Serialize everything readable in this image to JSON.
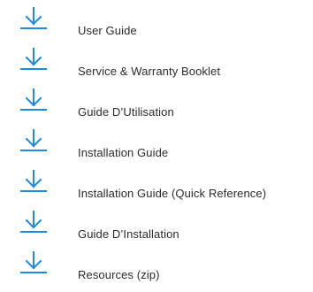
{
  "downloads": {
    "icon": "download-arrow-icon",
    "accent_color": "#1e88e5",
    "text_color": "#2b2b2b",
    "items": [
      {
        "label": "User Guide"
      },
      {
        "label": "Service & Warranty Booklet"
      },
      {
        "label": "Guide D’Utilisation"
      },
      {
        "label": "Installation Guide"
      },
      {
        "label": "Installation Guide (Quick Reference)"
      },
      {
        "label": "Guide D’Installation"
      },
      {
        "label": "Resources (zip)"
      }
    ]
  }
}
